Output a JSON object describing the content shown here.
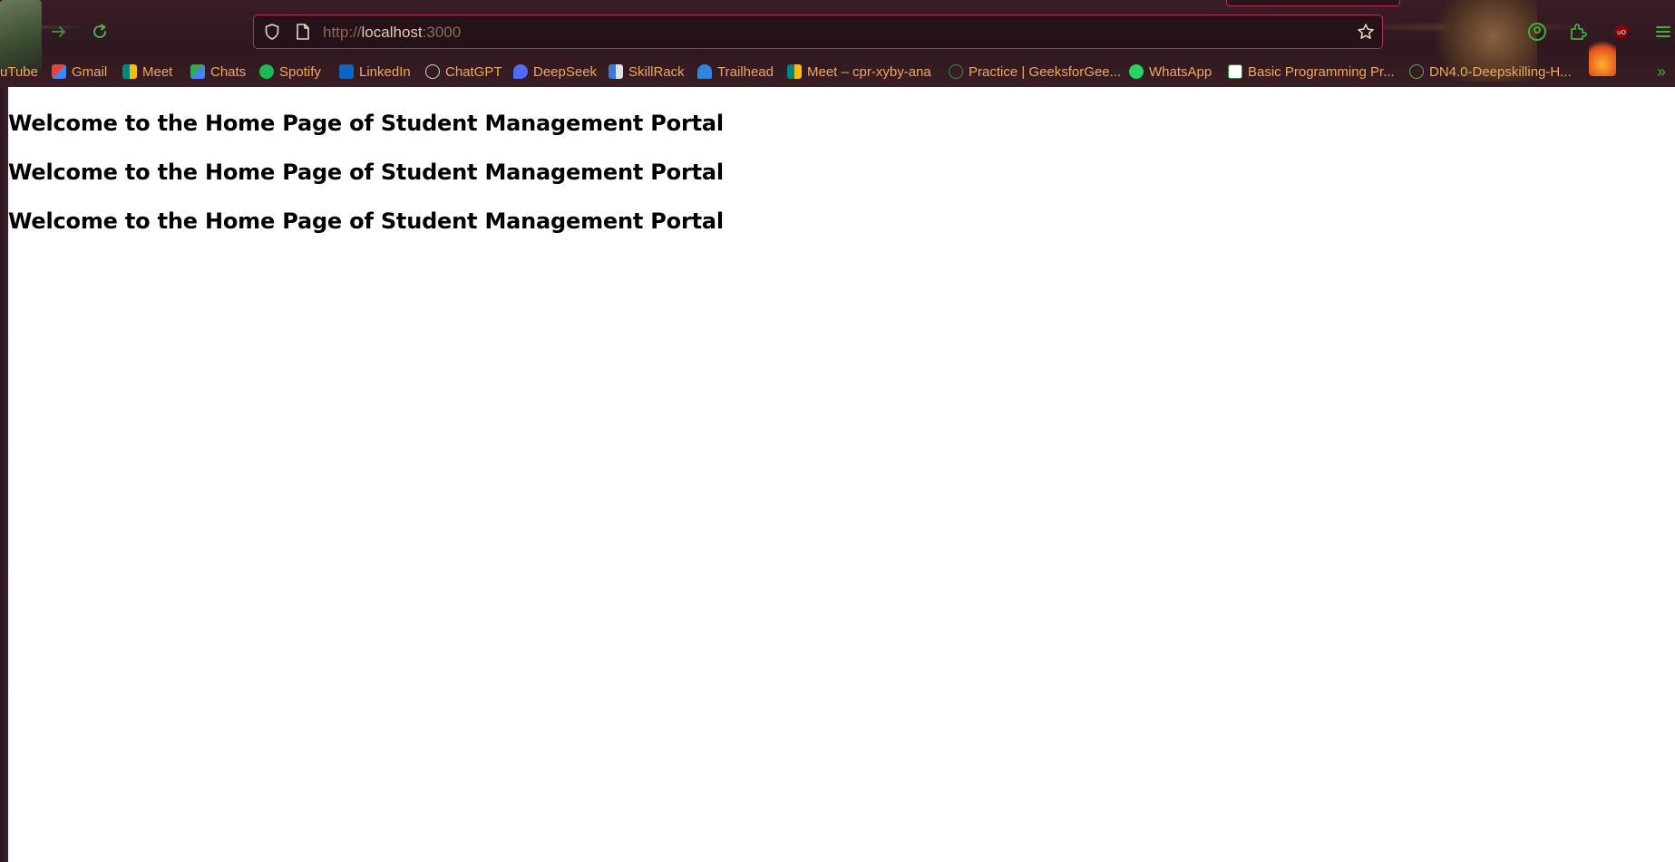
{
  "browser": {
    "url_scheme": "http://",
    "url_host": "localhost",
    "url_port": ":3000",
    "bookmarks": [
      {
        "label": "uTube",
        "icon": "youtube-icon",
        "color": "#e53935"
      },
      {
        "label": "Gmail",
        "icon": "gmail-icon",
        "color": "#ea4335"
      },
      {
        "label": "Meet",
        "icon": "meet-icon",
        "color": "#00897b"
      },
      {
        "label": "Chats",
        "icon": "chat-icon",
        "color": "#34a853"
      },
      {
        "label": "Spotify",
        "icon": "spotify-icon",
        "color": "#1db954"
      },
      {
        "label": "LinkedIn",
        "icon": "linkedin-icon",
        "color": "#0a66c2"
      },
      {
        "label": "ChatGPT",
        "icon": "chatgpt-icon",
        "color": "#d0d0d0"
      },
      {
        "label": "DeepSeek",
        "icon": "deepseek-icon",
        "color": "#4d6bfe"
      },
      {
        "label": "SkillRack",
        "icon": "skillrack-icon",
        "color": "#3c78d8"
      },
      {
        "label": "Trailhead",
        "icon": "trailhead-icon",
        "color": "#2e86de"
      },
      {
        "label": "Meet – cpr-xyby-ana",
        "icon": "meet-icon",
        "color": "#00897b"
      },
      {
        "label": "Practice | GeeksforGee...",
        "icon": "geeksforgeeks-icon",
        "color": "#2f8d46"
      },
      {
        "label": "WhatsApp",
        "icon": "whatsapp-icon",
        "color": "#25d366"
      },
      {
        "label": "Basic Programming Pr...",
        "icon": "geeksforgeeks-icon",
        "color": "#2f8d46"
      },
      {
        "label": "DN4.0-Deepskilling-H...",
        "icon": "globe-icon",
        "color": "#4caf50"
      }
    ],
    "accent_color": "#c0285a"
  },
  "page": {
    "headings": [
      "Welcome to the Home Page of Student Management Portal",
      "Welcome to the Home Page of Student Management Portal",
      "Welcome to the Home Page of Student Management Portal"
    ]
  }
}
